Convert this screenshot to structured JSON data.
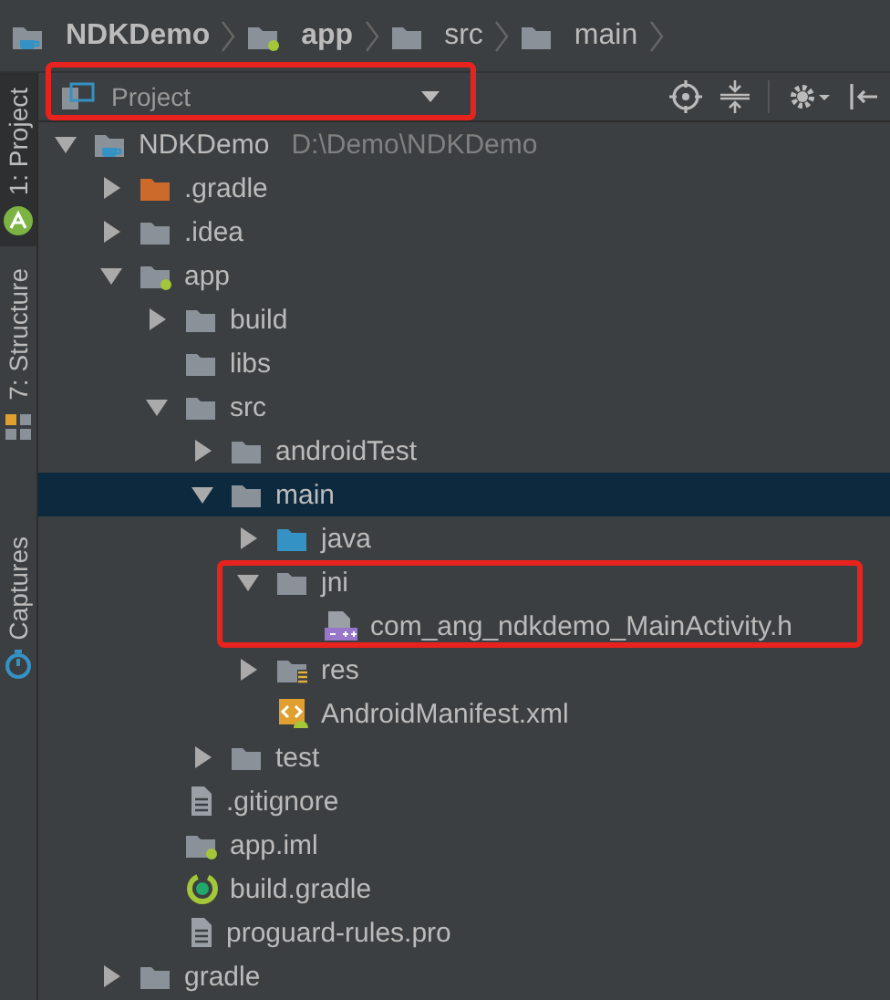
{
  "breadcrumbs": [
    {
      "label": "NDKDemo",
      "kind": "project"
    },
    {
      "label": "app",
      "kind": "module"
    },
    {
      "label": "src",
      "kind": "folder"
    },
    {
      "label": "main",
      "kind": "folder"
    }
  ],
  "tool_strip": [
    {
      "label": "1: Project",
      "kind": "project",
      "selected": true
    },
    {
      "label": "7: Structure",
      "kind": "structure",
      "selected": false
    },
    {
      "label": "Captures",
      "kind": "captures",
      "selected": false
    }
  ],
  "view_selector": {
    "label": "Project",
    "highlighted": true
  },
  "tree": [
    {
      "label": "NDKDemo",
      "path": "D:\\Demo\\NDKDemo",
      "kind": "project",
      "expanded": true,
      "selected": false,
      "children": [
        {
          "label": ".gradle",
          "kind": "excluded",
          "expanded": false,
          "selected": false
        },
        {
          "label": ".idea",
          "kind": "folder",
          "expanded": false,
          "selected": false
        },
        {
          "label": "app",
          "kind": "module",
          "expanded": true,
          "selected": false,
          "children": [
            {
              "label": "build",
              "kind": "folder",
              "expanded": false,
              "selected": false
            },
            {
              "label": "libs",
              "kind": "folder",
              "selected": false
            },
            {
              "label": "src",
              "kind": "folder",
              "expanded": true,
              "selected": false,
              "children": [
                {
                  "label": "androidTest",
                  "kind": "folder",
                  "expanded": false,
                  "selected": false
                },
                {
                  "label": "main",
                  "kind": "folder",
                  "expanded": true,
                  "selected": true,
                  "children": [
                    {
                      "label": "java",
                      "kind": "source",
                      "expanded": false,
                      "selected": false
                    },
                    {
                      "label": "jni",
                      "kind": "folder",
                      "expanded": true,
                      "selected": false,
                      "highlighted": true,
                      "children": [
                        {
                          "label": "com_ang_ndkdemo_MainActivity.h",
                          "kind": "header",
                          "selected": false
                        }
                      ]
                    },
                    {
                      "label": "res",
                      "kind": "resources",
                      "expanded": false,
                      "selected": false
                    },
                    {
                      "label": "AndroidManifest.xml",
                      "kind": "manifest",
                      "selected": false
                    }
                  ]
                },
                {
                  "label": "test",
                  "kind": "folder",
                  "expanded": false,
                  "selected": false
                }
              ]
            },
            {
              "label": ".gitignore",
              "kind": "text",
              "selected": false
            },
            {
              "label": "app.iml",
              "kind": "iml",
              "selected": false
            },
            {
              "label": "build.gradle",
              "kind": "gradle",
              "selected": false
            },
            {
              "label": "proguard-rules.pro",
              "kind": "text",
              "selected": false
            }
          ]
        },
        {
          "label": "gradle",
          "kind": "folder",
          "expanded": false,
          "selected": false
        }
      ]
    }
  ]
}
